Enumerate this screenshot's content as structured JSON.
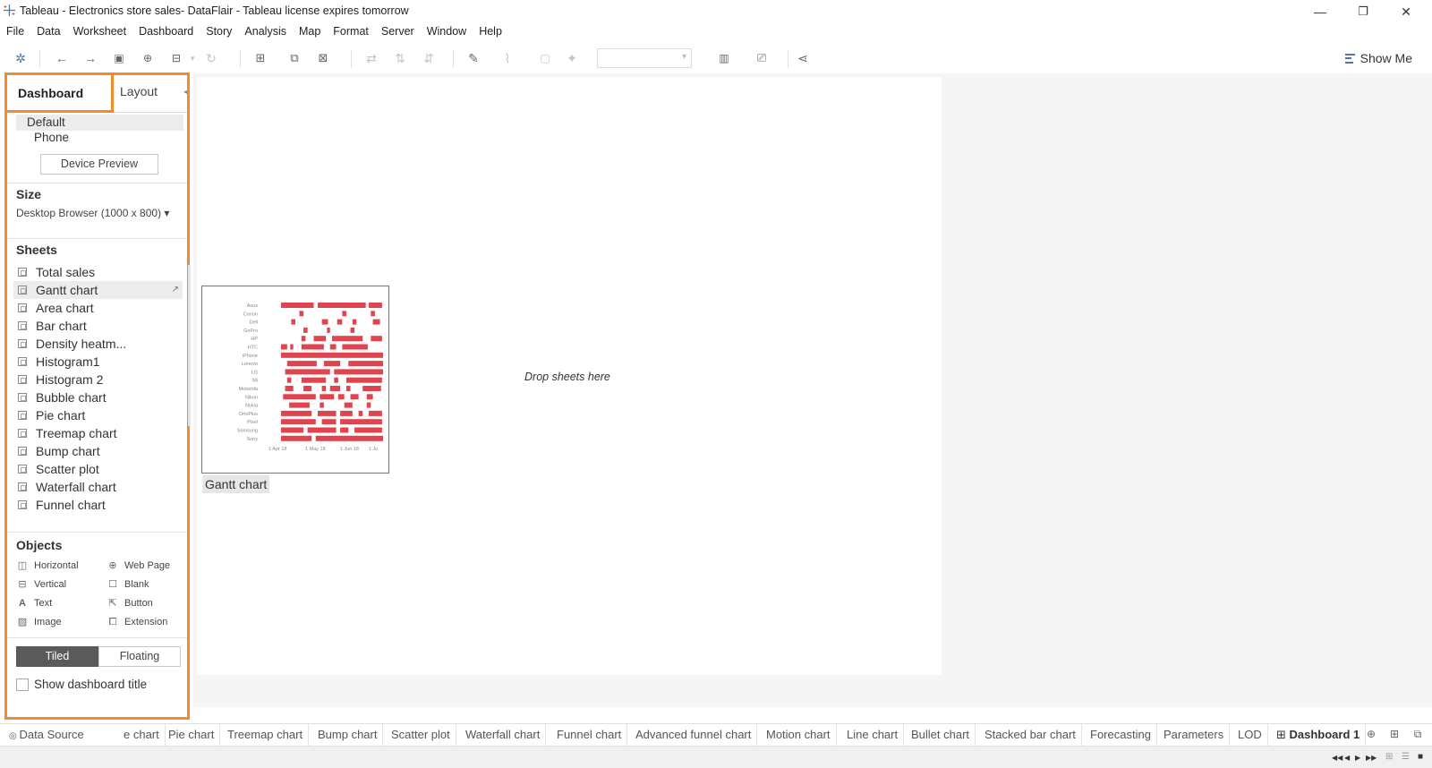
{
  "window": {
    "title": "Tableau - Electronics store sales- DataFlair - Tableau license expires tomorrow",
    "minimize": "—",
    "restore": "❐",
    "close": "✕"
  },
  "menu": [
    "File",
    "Data",
    "Worksheet",
    "Dashboard",
    "Story",
    "Analysis",
    "Map",
    "Format",
    "Server",
    "Window",
    "Help"
  ],
  "toolbar": {
    "show_me": "Show Me"
  },
  "panel": {
    "tabs": {
      "dashboard": "Dashboard",
      "layout": "Layout"
    },
    "devices": {
      "default": "Default",
      "phone": "Phone",
      "preview_button": "Device Preview"
    },
    "size": {
      "heading": "Size",
      "value": "Desktop Browser (1000 x 800) ▾"
    },
    "sheets": {
      "heading": "Sheets",
      "items": [
        "Total sales",
        "Gantt chart",
        "Area chart",
        "Bar chart",
        "Density heatm...",
        "Histogram1",
        "Histogram 2",
        "Bubble chart",
        "Pie chart",
        "Treemap chart",
        "Bump chart",
        "Scatter plot",
        "Waterfall chart",
        "Funnel chart"
      ],
      "selected": "Gantt chart"
    },
    "objects": {
      "heading": "Objects",
      "items": [
        "Horizontal",
        "Web Page",
        "Vertical",
        "Blank",
        "Text",
        "Button",
        "Image",
        "Extension"
      ]
    },
    "mode": {
      "tiled": "Tiled",
      "floating": "Floating"
    },
    "show_title": "Show dashboard title"
  },
  "canvas": {
    "drop_hint": "Drop sheets here",
    "sheet_caption": "Gantt chart"
  },
  "chart_data": {
    "type": "gantt",
    "categories": [
      "Asus",
      "Canon",
      "Dell",
      "GoPro",
      "HP",
      "HTC",
      "iPhone",
      "Lenovo",
      "LG",
      "Mi",
      "Motorola",
      "Nikon",
      "Nokia",
      "OnePlus",
      "Pixel",
      "Samsung",
      "Sony"
    ],
    "x_ticks": [
      "1 Apr 18",
      "1 May 18",
      "1 Jun 18",
      "1 Ju"
    ],
    "color": "#e0444e",
    "bars": [
      [
        [
          0.0,
          0.32
        ],
        [
          0.36,
          0.83
        ],
        [
          0.86,
          0.99
        ]
      ],
      [
        [
          0.18,
          0.22
        ],
        [
          0.6,
          0.64
        ],
        [
          0.88,
          0.92
        ]
      ],
      [
        [
          0.1,
          0.14
        ],
        [
          0.4,
          0.46
        ],
        [
          0.55,
          0.6
        ],
        [
          0.7,
          0.74
        ],
        [
          0.9,
          0.97
        ]
      ],
      [
        [
          0.22,
          0.26
        ],
        [
          0.45,
          0.48
        ],
        [
          0.68,
          0.72
        ]
      ],
      [
        [
          0.2,
          0.24
        ],
        [
          0.32,
          0.44
        ],
        [
          0.5,
          0.8
        ],
        [
          0.88,
          0.99
        ]
      ],
      [
        [
          0.0,
          0.06
        ],
        [
          0.09,
          0.12
        ],
        [
          0.2,
          0.42
        ],
        [
          0.48,
          0.54
        ],
        [
          0.6,
          0.85
        ]
      ],
      [
        [
          0.0,
          1.0
        ]
      ],
      [
        [
          0.06,
          0.35
        ],
        [
          0.42,
          0.58
        ],
        [
          0.66,
          1.0
        ]
      ],
      [
        [
          0.04,
          0.48
        ],
        [
          0.52,
          1.0
        ]
      ],
      [
        [
          0.06,
          0.1
        ],
        [
          0.2,
          0.44
        ],
        [
          0.52,
          0.56
        ],
        [
          0.64,
          0.99
        ]
      ],
      [
        [
          0.04,
          0.12
        ],
        [
          0.22,
          0.3
        ],
        [
          0.4,
          0.44
        ],
        [
          0.48,
          0.58
        ],
        [
          0.64,
          0.68
        ],
        [
          0.8,
          0.98
        ]
      ],
      [
        [
          0.02,
          0.34
        ],
        [
          0.38,
          0.52
        ],
        [
          0.56,
          0.62
        ],
        [
          0.68,
          0.76
        ],
        [
          0.84,
          0.9
        ]
      ],
      [
        [
          0.08,
          0.28
        ],
        [
          0.38,
          0.42
        ],
        [
          0.62,
          0.7
        ],
        [
          0.84,
          0.88
        ]
      ],
      [
        [
          0.0,
          0.3
        ],
        [
          0.36,
          0.54
        ],
        [
          0.58,
          0.7
        ],
        [
          0.76,
          0.8
        ],
        [
          0.86,
          0.99
        ]
      ],
      [
        [
          0.0,
          0.34
        ],
        [
          0.4,
          0.54
        ],
        [
          0.58,
          0.99
        ]
      ],
      [
        [
          0.0,
          0.22
        ],
        [
          0.26,
          0.54
        ],
        [
          0.58,
          0.66
        ],
        [
          0.72,
          0.99
        ]
      ],
      [
        [
          0.0,
          0.3
        ],
        [
          0.34,
          1.0
        ]
      ]
    ]
  },
  "bottom_tabs": {
    "data_source": "Data Source",
    "items": [
      "e chart",
      "Pie chart",
      "Treemap chart",
      "Bump chart",
      "Scatter plot",
      "Waterfall chart",
      "Funnel chart",
      "Advanced funnel chart",
      "Motion chart",
      "Line chart",
      "Bullet chart",
      "Stacked bar chart",
      "Forecasting",
      "Parameters",
      "LOD"
    ],
    "active": "Dashboard 1"
  }
}
